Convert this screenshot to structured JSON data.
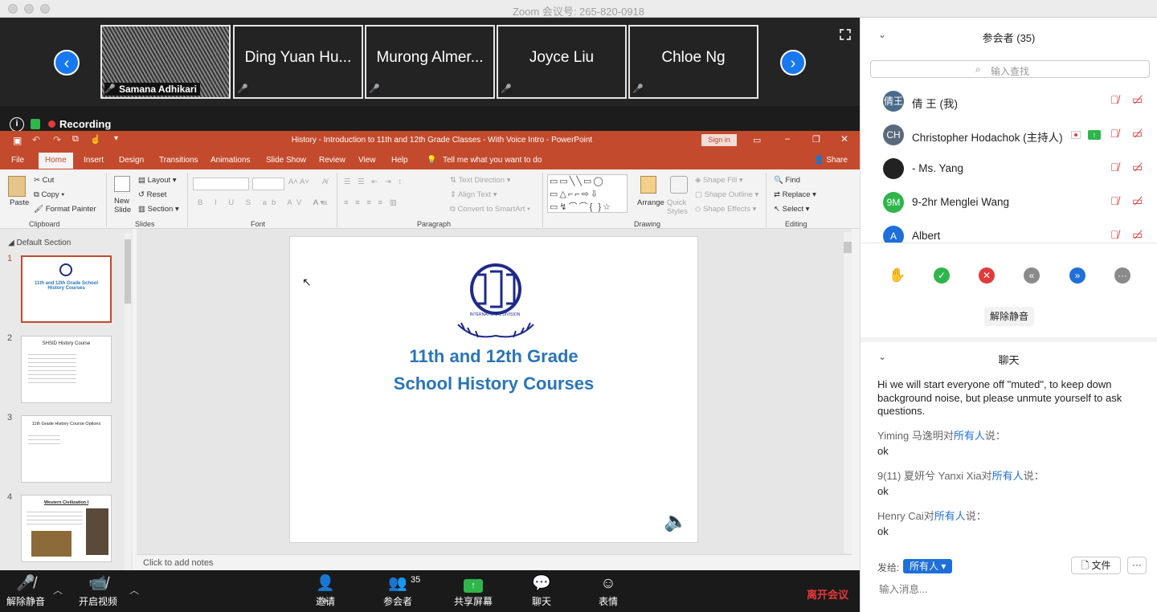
{
  "titlebar": {
    "title": "Zoom 会议号: 265-820-0918"
  },
  "gallery": {
    "tiles": [
      "Samana Adhikari",
      "Ding Yuan Hu...",
      "Murong Almer...",
      "Joyce Liu",
      "Chloe Ng"
    ]
  },
  "recording": {
    "label": "Recording"
  },
  "ppt": {
    "window_title": "History - Introduction to 11th and 12th Grade Classes - With Voice Intro - PowerPoint",
    "sign_in": "Sign in",
    "tabs": [
      "File",
      "Home",
      "Insert",
      "Design",
      "Transitions",
      "Animations",
      "Slide Show",
      "Review",
      "View",
      "Help"
    ],
    "tell_me": "Tell me what you want to do",
    "share": "Share",
    "clipboard": {
      "paste": "Paste",
      "cut": "Cut",
      "copy": "Copy",
      "format_painter": "Format Painter",
      "group": "Clipboard"
    },
    "slides": {
      "new_slide": "New Slide",
      "layout": "Layout",
      "reset": "Reset",
      "section": "Section",
      "group": "Slides"
    },
    "font_group": "Font",
    "paragraph": {
      "text_direction": "Text Direction",
      "align_text": "Align Text",
      "convert": "Convert to SmartArt",
      "group": "Paragraph"
    },
    "drawing": {
      "arrange": "Arrange",
      "quick_styles": "Quick Styles",
      "shape_fill": "Shape Fill",
      "shape_outline": "Shape Outline",
      "shape_effects": "Shape Effects",
      "group": "Drawing"
    },
    "editing": {
      "find": "Find",
      "replace": "Replace",
      "select": "Select",
      "group": "Editing"
    },
    "section_label": "Default Section",
    "thumbs": [
      {
        "num": "1",
        "text": "11th and 12th Grade School History Courses"
      },
      {
        "num": "2",
        "text": "SHSID History Course"
      },
      {
        "num": "3",
        "text": "11th Grade History Course Options"
      },
      {
        "num": "4",
        "text": "Western Civilization I"
      }
    ],
    "slide": {
      "logo_text": "INTERNATIONAL DIVISION",
      "line1": "11th and 12th Grade",
      "line2": "School History Courses"
    },
    "notes": "Click to add notes"
  },
  "toolbar": {
    "unmute": "解除静音",
    "start_video": "开启视频",
    "invite": "邀请",
    "participants": "参会者",
    "participant_count": "35",
    "share_screen": "共享屏幕",
    "chat": "聊天",
    "reactions": "表情",
    "leave": "离开会议"
  },
  "participants_panel": {
    "title": "参会者 (35)",
    "search_placeholder": "输入查找",
    "people": [
      {
        "initials": "倩王",
        "name": "倩 王 (我)",
        "color": "#4a6b8c"
      },
      {
        "initials": "CH",
        "name": "Christopher Hodachok (主持人)",
        "color": "#5a6a7a"
      },
      {
        "initials": "",
        "name": "- Ms. Yang",
        "color": "#222222"
      },
      {
        "initials": "9M",
        "name": "9-2hr Menglei Wang",
        "color": "#2fb54a"
      },
      {
        "initials": "A",
        "name": "Albert",
        "color": "#1e6fd9"
      }
    ],
    "unmute_all": "解除静音"
  },
  "chat_panel": {
    "title": "聊天",
    "messages": [
      {
        "sender": "",
        "to": "",
        "text": "Hi we will start everyone off \"muted\", to keep down background noise, but please unmute yourself to ask questions."
      },
      {
        "sender": "Yiming 马逸明对",
        "to": "所有人",
        "suffix": "说：",
        "text": "ok"
      },
      {
        "sender": "9(11) 夏妍兮 Yanxi Xia对",
        "to": "所有人",
        "suffix": "说：",
        "text": "ok"
      },
      {
        "sender": "Henry Cai对",
        "to": "所有人",
        "suffix": "说：",
        "text": "ok"
      }
    ],
    "send_to_label": "发给:",
    "send_to_value": "所有人",
    "file_button": "文件",
    "input_placeholder": "输入消息..."
  }
}
